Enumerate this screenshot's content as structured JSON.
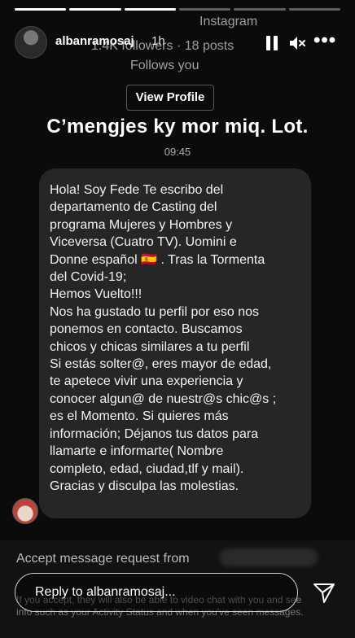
{
  "story": {
    "segments": 6,
    "current_segment": 3,
    "username": "albanramosaj",
    "time": "1h"
  },
  "background_profile": {
    "instagram": "Instagram",
    "followers": "1.4K followers · 18 posts",
    "follows_you": "Follows you",
    "view_profile_label": "View Profile"
  },
  "overlay_title": "C’mengjes ky mor miq. Lot.",
  "message_time": "09:45",
  "message": {
    "lines": [
      "Hola! Soy Fede Te escribo del",
      "departamento de Casting del",
      "programa Mujeres y Hombres y",
      "Viceversa (Cuatro TV). Uomini e",
      "Donne español 🇪🇸 . Tras la Tormenta",
      "del Covid-19;",
      "Hemos Vuelto!!!",
      "Nos ha gustado tu perfil por eso nos",
      "ponemos en contacto. Buscamos",
      "chicos y chicas similares a tu perfil",
      "Si estás solter@, eres mayor de edad,",
      "te apetece vivir una experiencia y",
      "conocer algun@ de nuestr@s chic@s ;",
      "es el Momento. Si quieres más",
      "información; Déjanos tus datos para",
      "llamarte e informarte( Nombre",
      "completo, edad, ciudad,tlf y mail).",
      "Gracias y disculpa las molestias."
    ]
  },
  "accept_request": {
    "text": "Accept message request from",
    "info_line1": "If you accept, they will also be able to video chat with you and see",
    "info_line2": "info such as your Activity Status and when you've seen messages."
  },
  "reply": {
    "placeholder": "Reply to albanramosaj..."
  },
  "icons": [
    "pause-icon",
    "mute-icon",
    "more-icon",
    "send-icon"
  ]
}
